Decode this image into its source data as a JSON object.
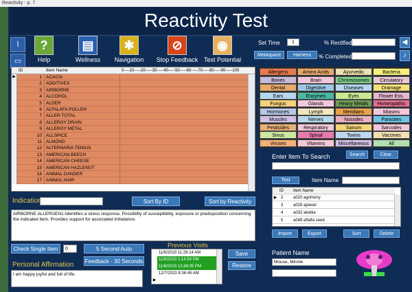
{
  "window_title": "Reactivity - p. 7",
  "app_title": "Reactivity Test",
  "toolbar": [
    {
      "label": "Help",
      "icon": "?"
    },
    {
      "label": "Wellness",
      "icon": "▤"
    },
    {
      "label": "Navigation",
      "icon": "✱"
    },
    {
      "label": "Stop Feedback",
      "icon": "⊘"
    },
    {
      "label": "Test Potential",
      "icon": "◉"
    }
  ],
  "settime": {
    "label": "Set Time",
    "value": "1",
    "rectified_label": "% Rectified",
    "completed_label": "% Completed",
    "metaspace": "Metaspace",
    "harness": "Harness"
  },
  "grid": {
    "col_id": "ID",
    "col_name": "Item Name",
    "col_scale": "0----10-----20-----30-----40-----50-----60-----70-----80-----90-----100",
    "rows": [
      {
        "id": "1",
        "name": "ACACIA"
      },
      {
        "id": "2",
        "name": "ADDITIVES"
      },
      {
        "id": "3",
        "name": "AIRBORNE"
      },
      {
        "id": "4",
        "name": "ALCOHOL"
      },
      {
        "id": "5",
        "name": "ALDER"
      },
      {
        "id": "6",
        "name": "ALFALAFA POLLEN"
      },
      {
        "id": "7",
        "name": "ALLER-TOTAL"
      },
      {
        "id": "8",
        "name": "ALLERGY DRAIN"
      },
      {
        "id": "9",
        "name": "ALLERGY METAL"
      },
      {
        "id": "10",
        "name": "ALLSPICE"
      },
      {
        "id": "11",
        "name": "ALMOND"
      },
      {
        "id": "12",
        "name": "ALTERNARIA TENIUS"
      },
      {
        "id": "13",
        "name": "AMERICAN BEECH"
      },
      {
        "id": "14",
        "name": "AMERICAN CHEESE"
      },
      {
        "id": "15",
        "name": "AMERICAN HAZLENUT"
      },
      {
        "id": "16",
        "name": "ANIMAL DANDER"
      },
      {
        "id": "17",
        "name": "ANIMAL HAIR"
      }
    ]
  },
  "categories": [
    [
      "Allergens",
      "Amino Acids",
      "Ayurvedic",
      "Bacteria"
    ],
    [
      "Bones",
      "Brain",
      "Chromosomes",
      "Circulatory"
    ],
    [
      "Dental",
      "Digestive",
      "Diseases",
      "Drainage"
    ],
    [
      "Ears",
      "Enzymes",
      "Eyes",
      "Flower Ess."
    ],
    [
      "Fungus",
      "Glands",
      "Heavy Metals",
      "Homeopathic"
    ],
    [
      "Hormones",
      "Lymph",
      "Meridians",
      "Miasms"
    ],
    [
      "Muscles",
      "Nerves",
      "Nosodes",
      "Parasites"
    ],
    [
      "Pesticides",
      "Respiratory",
      "Sanum",
      "Sarcodes"
    ],
    [
      "Sinus",
      "Spinal",
      "Toxins",
      "Vaccines"
    ],
    [
      "Viruses",
      "Vitamins",
      "Miscellaneous",
      "All"
    ]
  ],
  "category_colors": [
    [
      "#e97a4f",
      "#e6a96b",
      "#e8e0b0",
      "#f6f07a"
    ],
    [
      "#c8b9d8",
      "#f2c7d9",
      "#7fd08a",
      "#e8c7d6"
    ],
    [
      "#e6a96b",
      "#9ec6e6",
      "#b6d8ee",
      "#f7e07a"
    ],
    [
      "#b6d8ee",
      "#49b8a5",
      "#c9e892",
      "#e8b8d0"
    ],
    [
      "#f7d07a",
      "#f2c7d9",
      "#6f9d56",
      "#e06c8f"
    ],
    [
      "#b6c9e6",
      "#f2e6c0",
      "#e8a24f",
      "#f2c7d9"
    ],
    [
      "#cfc0e6",
      "#b6d8ee",
      "#e8b0c0",
      "#6fc3e6"
    ],
    [
      "#e8b07a",
      "#f2c7d9",
      "#f2d27a",
      "#f2c7d9"
    ],
    [
      "#cfe8a0",
      "#e87ab0",
      "#c0d8ee",
      "#f2e0b0"
    ],
    [
      "#f2b07a",
      "#f2c7d9",
      "#cfc0e6",
      "#b0e0b0"
    ]
  ],
  "indication": {
    "label": "Indication",
    "sort_id": "Sort By ID",
    "sort_reactivity": "Sort by Reactivity",
    "description": "AIRBORNE ALLERGEN1-Identifies a stress response. Possibility of susceptibility, exposure or predisposition concerning the indicated item. Provides support for associated imbalance."
  },
  "search": {
    "label": "Enter Item To Search",
    "search_btn": "Search",
    "clear_btn": "Clear",
    "test_btn": "Test",
    "item_name_label": "Item Name",
    "col_id": "ID",
    "col_name": "Item Name",
    "rows": [
      {
        "id": "2",
        "name": "a020 agrimony"
      },
      {
        "id": "3",
        "name": "a028 ajowan"
      },
      {
        "id": "4",
        "name": "a032 akebia"
      },
      {
        "id": "5",
        "name": "a048 alfalfa seed"
      }
    ],
    "import": "Import",
    "export": "Export",
    "sort": "Sort",
    "delete": "Delete"
  },
  "bottom": {
    "check_single": "Check Single Item",
    "check_value": "0",
    "five_sec": "5 Second Auto",
    "feedback": "Feedback - 30 Seconds",
    "prev_visits_label": "Previous Visits",
    "visits": [
      "11/6/2023 11:28:14 AM",
      "11/6/2023 1:14:54 PM",
      "11/6/2023 12:48:05 PM",
      "12/7/2023 8:36:45 AM"
    ],
    "save": "Save",
    "restore": "Restore",
    "affirmation_label": "Personal Affirmation",
    "affirmation_text": "I am happy joyful and full of life."
  },
  "patient": {
    "label": "Patient Name",
    "name": "Mouse, Minnie"
  }
}
